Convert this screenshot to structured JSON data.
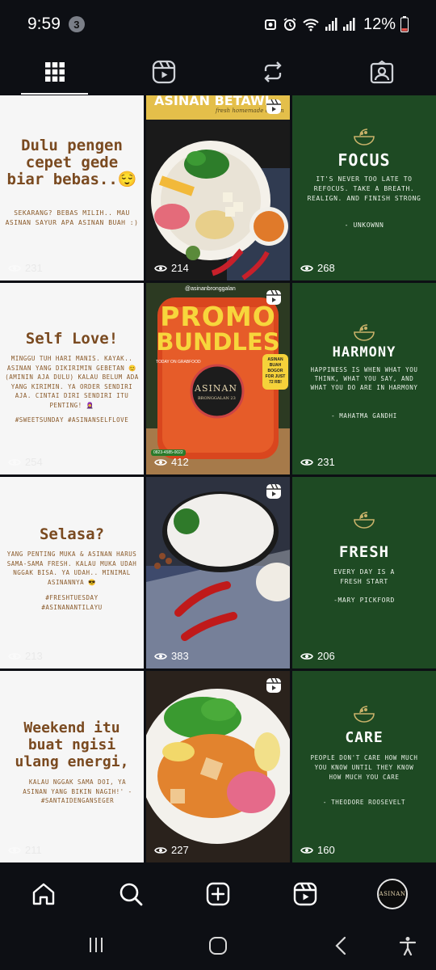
{
  "status_bar": {
    "time": "9:59",
    "notification_count": "3",
    "battery": "12%"
  },
  "tabs": [
    {
      "icon": "grid-icon",
      "active": true
    },
    {
      "icon": "reels-icon",
      "active": false
    },
    {
      "icon": "repost-icon",
      "active": false
    },
    {
      "icon": "tagged-icon",
      "active": false
    }
  ],
  "posts": {
    "p1": {
      "title": "Dulu pengen cepet gede biar bebas..😌",
      "body": "SEKARANG? BEBAS MILIH.. MAU ASINAN SAYUR APA ASINAN BUAH :)",
      "views": "231"
    },
    "p2": {
      "banner": "ASINAN BETAWI",
      "sub": "fresh homemade asinan",
      "views": "214"
    },
    "p3": {
      "title": "FOCUS",
      "quote": "IT'S NEVER TOO LATE TO REFOCUS. TAKE A BREATH. REALIGN. AND FINISH STRONG",
      "author": "- UNKOWNN",
      "views": "268"
    },
    "p4": {
      "title": "Self Love!",
      "body": "MINGGU TUH HARI MANIS. KAYAK.. ASINAN YANG DIKIRIMIN GEBETAN 😊 (AMININ AJA DULU) KALAU BELUM ADA YANG KIRIMIN. YA ORDER SENDIRI AJA. CINTAI DIRI SENDIRI ITU PENTING! 🧕",
      "tags": "#SWEETSUNDAY #ASINANSELFLOVE",
      "views": "254"
    },
    "p5": {
      "handle": "@asinanbronggalan",
      "line1": "PROMO",
      "line2": "BUNDLES",
      "brand": "ASINAN",
      "brand_sub": "BRONGGALAN 23",
      "sticker": "ASINAN BUAH BOGOR FOR JUST 72 RB!",
      "caption": "TODAY ON GRABFOOD",
      "phone": "0823-4585-0022",
      "views": "412"
    },
    "p6": {
      "title": "HARMONY",
      "quote": "HAPPINESS IS WHEN WHAT YOU THINK, WHAT YOU SAY, AND WHAT YOU DO ARE IN HARMONY",
      "author": "- MAHATMA GANDHI",
      "views": "231"
    },
    "p7": {
      "title": "Selasa?",
      "body": "YANG PENTING MUKA & ASINAN HARUS SAMA-SAMA FRESH. KALAU MUKA UDAH NGGAK BISA. YA UDAH.. MINIMAL ASINANNYA 😎",
      "tags": "#FRESHTUESDAY #ASINANANTILAYU",
      "views": "213"
    },
    "p8": {
      "views": "383"
    },
    "p9": {
      "title": "FRESH",
      "quote": "EVERY DAY IS A FRESH START",
      "author": "-MARY PICKFORD",
      "views": "206"
    },
    "p10": {
      "title": "Weekend itu buat ngisi ulang energi,",
      "body": "KALAU NGGAK SAMA DOI, YA ASINAN YANG BIKIN NAGIH!' - #SANTAIDENGANSEGER",
      "views": "211"
    },
    "p11": {
      "views": "227"
    },
    "p12": {
      "title": "CARE",
      "quote": "PEOPLE DON'T CARE HOW MUCH YOU KNOW UNTIL THEY KNOW HOW MUCH YOU CARE",
      "author": "- THEODORE ROOSEVELT",
      "views": "160"
    }
  },
  "bottom_nav": {
    "avatar_text": "ASINAN"
  },
  "colors": {
    "green_tile": "#1e4a23",
    "brown_text": "#7a4a20",
    "background": "#0d0f14"
  }
}
